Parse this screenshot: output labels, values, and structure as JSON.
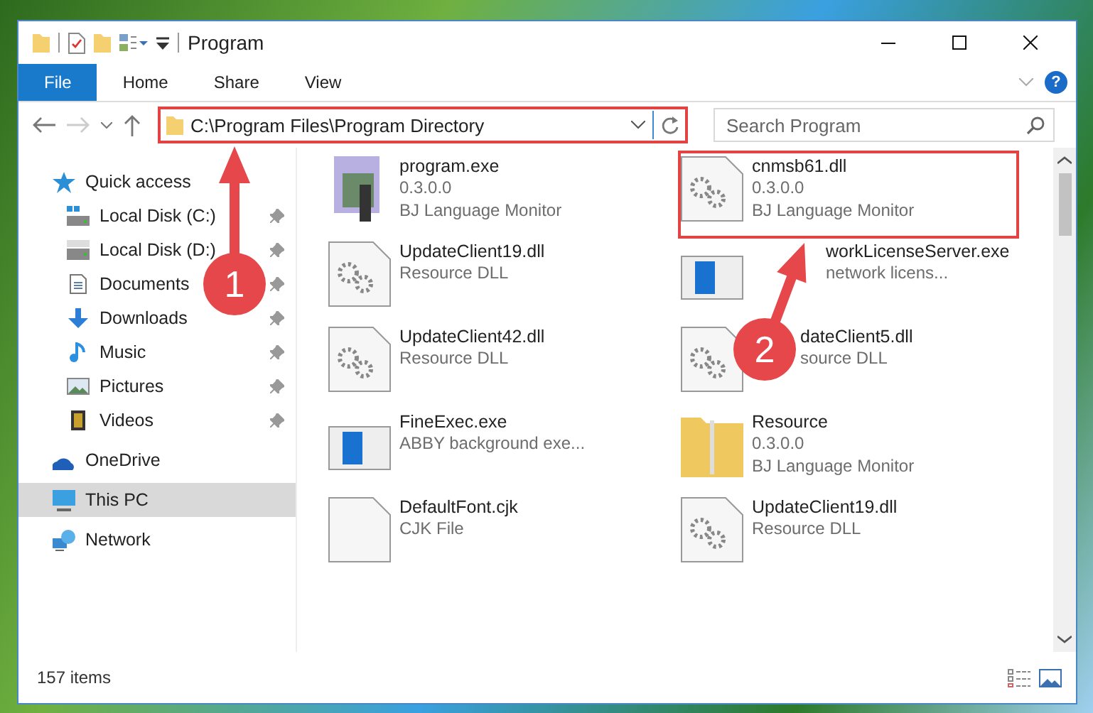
{
  "window": {
    "title": "Program"
  },
  "ribbon_tabs": [
    {
      "label": "File",
      "selected": true
    },
    {
      "label": "Home",
      "selected": false
    },
    {
      "label": "Share",
      "selected": false
    },
    {
      "label": "View",
      "selected": false
    }
  ],
  "help_label": "?",
  "address": {
    "path": "C:\\Program Files\\Program Directory"
  },
  "search": {
    "placeholder": "Search Program"
  },
  "sidebar": {
    "items": [
      {
        "label": "Quick access",
        "kind": "star",
        "selected": false,
        "children": [
          {
            "label": "Local Disk (C:)",
            "kind": "system-drive",
            "pinned": true
          },
          {
            "label": "Local Disk (D:)",
            "kind": "drive",
            "pinned": true
          },
          {
            "label": "Documents",
            "kind": "document",
            "pinned": true
          },
          {
            "label": "Downloads",
            "kind": "download",
            "pinned": true
          },
          {
            "label": "Music",
            "kind": "music",
            "pinned": true
          },
          {
            "label": "Pictures",
            "kind": "picture",
            "pinned": true
          },
          {
            "label": "Videos",
            "kind": "video",
            "pinned": true
          }
        ]
      },
      {
        "label": "OneDrive",
        "kind": "cloud",
        "selected": false
      },
      {
        "label": "This PC",
        "kind": "computer",
        "selected": true
      },
      {
        "label": "Network",
        "kind": "network",
        "selected": false
      }
    ]
  },
  "files": [
    {
      "name": "program.exe",
      "details": [
        "0.3.0.0",
        "BJ Language Monitor"
      ],
      "kind": "installer"
    },
    {
      "name": "cnmsb61.dll",
      "details": [
        "0.3.0.0",
        "BJ Language Monitor"
      ],
      "kind": "gear-file"
    },
    {
      "name": "UpdateClient19.dll",
      "details": [
        "Resource DLL"
      ],
      "kind": "gear-file"
    },
    {
      "name": "workLicenseServer.exe",
      "details": [
        "network licens..."
      ],
      "kind": "window-app"
    },
    {
      "name": "UpdateClient42.dll",
      "details": [
        "Resource DLL"
      ],
      "kind": "gear-file"
    },
    {
      "name": "dateClient5.dll",
      "details": [
        "source DLL"
      ],
      "kind": "gear-file"
    },
    {
      "name": "FineExec.exe",
      "details": [
        "ABBY background exe..."
      ],
      "kind": "window-app"
    },
    {
      "name": "Resource",
      "details": [
        "0.3.0.0",
        "BJ Language Monitor"
      ],
      "kind": "folder"
    },
    {
      "name": "DefaultFont.cjk",
      "details": [
        "CJK File"
      ],
      "kind": "blank-file"
    },
    {
      "name": "UpdateClient19.dll",
      "details": [
        "Resource DLL"
      ],
      "kind": "gear-file"
    }
  ],
  "status_bar": {
    "item_count": "157 items"
  },
  "annotations": [
    {
      "label": "1"
    },
    {
      "label": "2"
    }
  ]
}
